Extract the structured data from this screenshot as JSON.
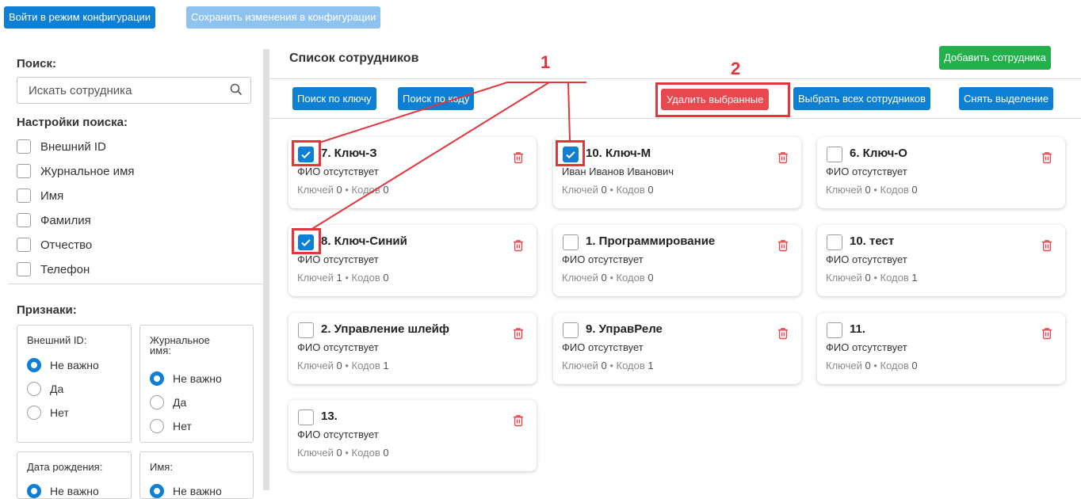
{
  "toolbar": {
    "enter_config": "Войти в режим конфигурации",
    "save_config": "Сохранить изменения в конфигурации"
  },
  "sidebar": {
    "search_title": "Поиск:",
    "search_placeholder": "Искать сотрудника",
    "settings_title": "Настройки поиска:",
    "options": [
      "Внешний ID",
      "Журнальное имя",
      "Имя",
      "Фамилия",
      "Отчество",
      "Телефон"
    ],
    "features_title": "Признаки:",
    "filters": [
      {
        "title": "Внешний ID:",
        "options": [
          "Не важно",
          "Да",
          "Нет"
        ],
        "selected": "Не важно"
      },
      {
        "title": "Журнальное имя:",
        "options": [
          "Не важно",
          "Да",
          "Нет"
        ],
        "selected": "Не важно"
      },
      {
        "title": "Дата рождения:",
        "options": [
          "Не важно"
        ],
        "selected": "Не важно"
      },
      {
        "title": "Имя:",
        "options": [
          "Не важно"
        ],
        "selected": "Не важно"
      }
    ]
  },
  "main": {
    "title": "Список сотрудников",
    "add_button": "Добавить сотрудника",
    "search_key": "Поиск по ключу",
    "search_code": "Поиск по коду",
    "delete_selected": "Удалить выбранные",
    "select_all": "Выбрать всех сотрудников",
    "deselect": "Снять выделение",
    "keys_label": "Ключей",
    "codes_label": "Кодов",
    "cards": [
      {
        "title": "7. Ключ-З",
        "name": "ФИО отсутствует",
        "keys": "0",
        "codes": "0",
        "checked": true
      },
      {
        "title": "10. Ключ-М",
        "name": "Иван Иванов Иванович",
        "keys": "0",
        "codes": "0",
        "checked": true
      },
      {
        "title": "6. Ключ-О",
        "name": "ФИО отсутствует",
        "keys": "0",
        "codes": "0",
        "checked": false
      },
      {
        "title": "8. Ключ-Синий",
        "name": "ФИО отсутствует",
        "keys": "1",
        "codes": "0",
        "checked": true
      },
      {
        "title": "1. Программирование",
        "name": "ФИО отсутствует",
        "keys": "0",
        "codes": "0",
        "checked": false
      },
      {
        "title": "10. тест",
        "name": "ФИО отсутствует",
        "keys": "0",
        "codes": "1",
        "checked": false
      },
      {
        "title": "2. Управление шлейф",
        "name": "ФИО отсутствует",
        "keys": "0",
        "codes": "1",
        "checked": false
      },
      {
        "title": "9. УправРеле",
        "name": "ФИО отсутствует",
        "keys": "0",
        "codes": "1",
        "checked": false
      },
      {
        "title": "11.",
        "name": "ФИО отсутствует",
        "keys": "0",
        "codes": "0",
        "checked": false
      },
      {
        "title": "13.",
        "name": "ФИО отсутствует",
        "keys": "0",
        "codes": "0",
        "checked": false
      }
    ]
  },
  "annotations": {
    "label1": "1",
    "label2": "2"
  },
  "colors": {
    "primary": "#0d7fd4",
    "success": "#22b04a",
    "danger": "#e8484e",
    "annotation": "#e0363c"
  }
}
